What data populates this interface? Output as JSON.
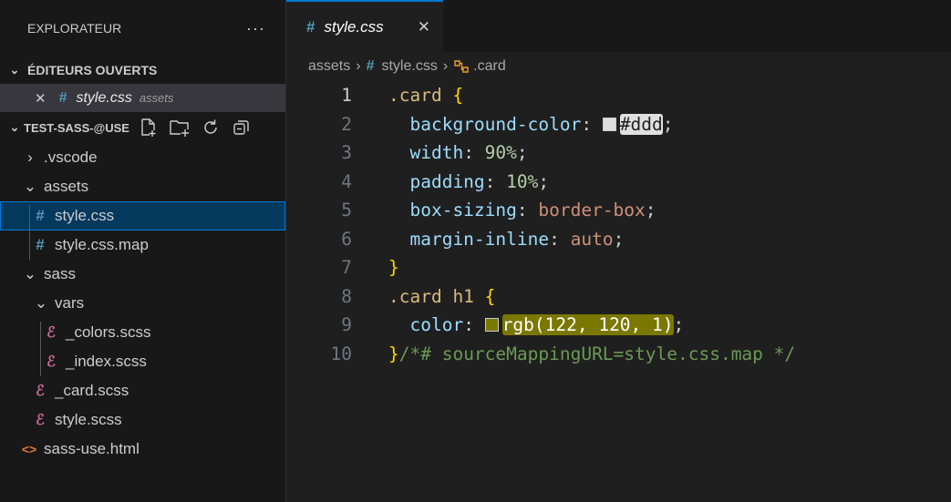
{
  "sidebar": {
    "title": "EXPLORATEUR",
    "more": "···",
    "open_editors": {
      "label": "ÉDITEURS OUVERTS",
      "item": {
        "close": "✕",
        "icon": "#",
        "name": "style.css",
        "description": "assets"
      }
    },
    "project": {
      "label": "TEST-SASS-@USE"
    },
    "tree": [
      {
        "label": ".vscode",
        "kind": "folder-collapsed"
      },
      {
        "label": "assets",
        "kind": "folder-expanded"
      },
      {
        "label": "style.css",
        "kind": "css"
      },
      {
        "label": "style.css.map",
        "kind": "css"
      },
      {
        "label": "sass",
        "kind": "folder-expanded"
      },
      {
        "label": "vars",
        "kind": "folder-expanded"
      },
      {
        "label": "_colors.scss",
        "kind": "sass"
      },
      {
        "label": "_index.scss",
        "kind": "sass"
      },
      {
        "label": "_card.scss",
        "kind": "sass"
      },
      {
        "label": "style.scss",
        "kind": "sass"
      },
      {
        "label": "sass-use.html",
        "kind": "html"
      }
    ],
    "icons": {
      "css": "#",
      "sass": "ℰ",
      "html": "<>",
      "chevron_right": "›",
      "chevron_down": "⌄"
    }
  },
  "editor": {
    "tab": {
      "label": "style.css",
      "icon": "#",
      "close": "✕"
    },
    "breadcrumb": {
      "folder": "assets",
      "sep": "›",
      "file_icon": "#",
      "file": "style.css",
      "symbol": ".card"
    },
    "line_numbers": [
      "1",
      "2",
      "3",
      "4",
      "5",
      "6",
      "7",
      "8",
      "9",
      "10"
    ],
    "code": {
      "l1_sel": ".card",
      "brace_open": "{",
      "brace_close": "}",
      "l2_prop": "background-color",
      "l2_val": "#ddd",
      "l3_prop": "width",
      "l3_val": "90%",
      "l4_prop": "padding",
      "l4_val": "10%",
      "l5_prop": "box-sizing",
      "l5_val": "border-box",
      "l6_prop": "margin-inline",
      "l6_val": "auto",
      "l8_sel": ".card h1",
      "l9_prop": "color",
      "l9_val": "rgb(122, 120, 1)",
      "l10_comment": "/*# sourceMappingURL=style.css.map */"
    },
    "swatches": {
      "ddd": "#dddddd",
      "rgb": "#7a7801"
    }
  }
}
